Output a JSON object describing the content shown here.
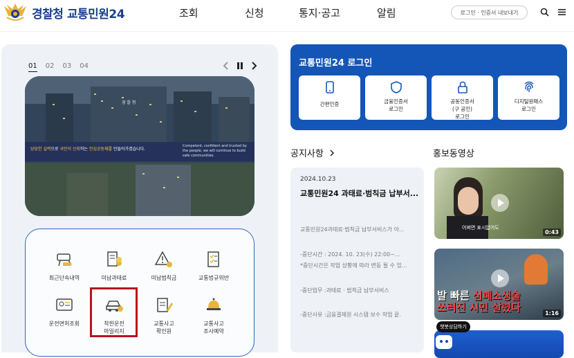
{
  "header": {
    "logo_prefix": "경찰청",
    "logo_name": "교통민원24",
    "nav": [
      "조회",
      "신청",
      "통지·공고",
      "알림"
    ],
    "login_label": "로그인 · 인증서 내보내기"
  },
  "slider": {
    "tabs": [
      "01",
      "02",
      "03",
      "04"
    ],
    "active_tab": "01",
    "building_sign": "경 찰 청",
    "caption_lead": "당당한 실력",
    "caption_mid1": "으로 ",
    "caption_hl1": "국민이 신뢰",
    "caption_mid2": "하는 ",
    "caption_hl2": "안심공동체를",
    "caption_tail": " 만들어가겠습니다.",
    "caption_en": "Competent, confident and trusted by the people, we will continue to build safe communities."
  },
  "quick_menu": [
    {
      "label": "최근단속내역",
      "icon": "camera-car-icon"
    },
    {
      "label": "미납과태료",
      "icon": "receipt-coins-icon"
    },
    {
      "label": "미납범칙금",
      "icon": "warning-coins-icon"
    },
    {
      "label": "교통법규위반",
      "icon": "checklist-icon"
    },
    {
      "label": "운전면허조회",
      "icon": "license-card-icon"
    },
    {
      "label": "착한운전\n마일리지",
      "icon": "car-coins-icon"
    },
    {
      "label": "교통사고\n확인원",
      "icon": "document-pen-icon"
    },
    {
      "label": "교통사고\n조사예약",
      "icon": "bell-calendar-icon"
    }
  ],
  "login_panel": {
    "title": "교통민원24 로그인",
    "cards": [
      {
        "label": "간편인증",
        "icon": "phone-icon"
      },
      {
        "label": "금융인증서\n로그인",
        "icon": "shield-icon"
      },
      {
        "label": "공동인증서\n(구 공인)\n로그인",
        "icon": "lock-icon"
      },
      {
        "label": "디지털원패스\n로그인",
        "icon": "fingerprint-icon"
      }
    ]
  },
  "notice": {
    "title": "공지사항",
    "date": "2024.10.23",
    "headline": "교통민원24 과태료·범칙금 납부서...",
    "lines": [
      "교통민원24과태료·범칙금 납부서비스가 아...",
      "-중단시간 : 2024. 10. 23(수) 22:00~...",
      "*중단시간은 작업 상황에 따라 변동 될 수 있...",
      "-중단업무 :과태료 · 범칙금 납부서비스",
      "-중단사유 :금융결제원 시스템 보수 작업 끝."
    ]
  },
  "videos": {
    "title": "홍보동영상",
    "items": [
      {
        "duration": "0:43",
        "caption": "어쩌면 표시없어도"
      },
      {
        "duration": "1:16",
        "caption_line1": "발 빠른 ",
        "caption_red": "심폐소생술",
        "caption_line2": "쓰러진 시민 살렸다"
      }
    ],
    "chat_label": "챗봇상담하기"
  },
  "colors": {
    "brand_blue": "#1456b8",
    "logo_blue": "#1a3d8f",
    "highlight_red": "#b3141c"
  }
}
